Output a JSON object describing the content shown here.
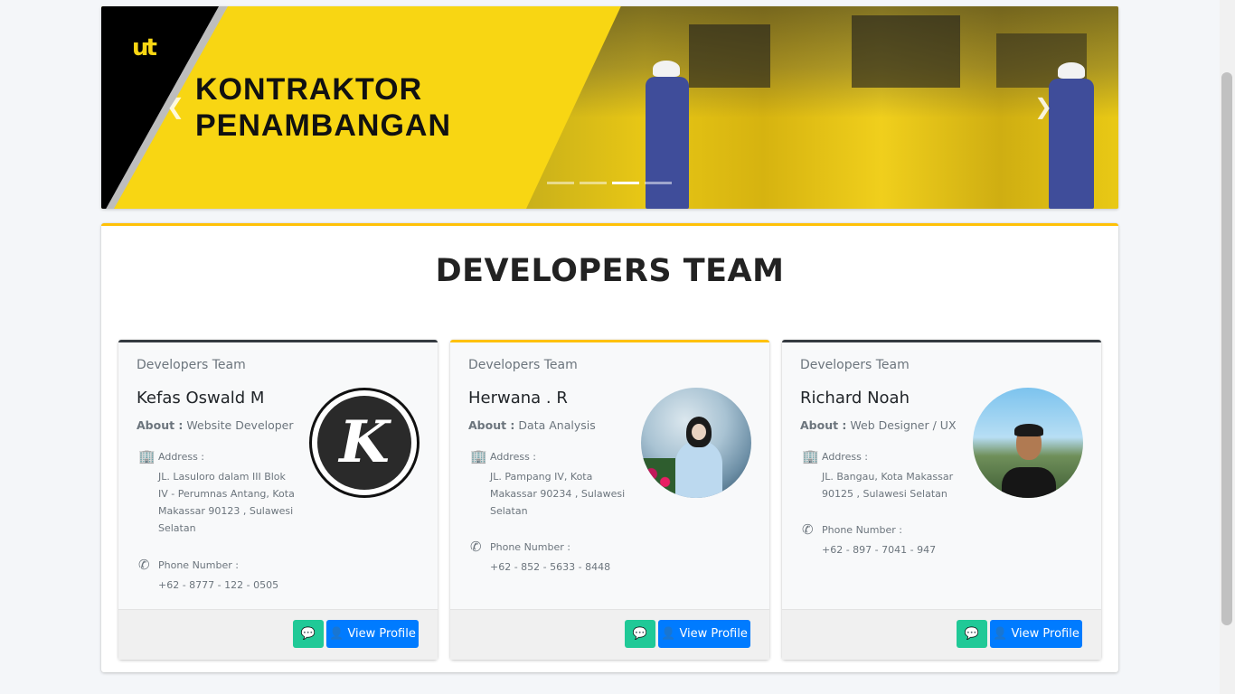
{
  "banner": {
    "headline_line1": "KONTRAKTOR",
    "headline_line2": "PENAMBANGAN",
    "logo_text": "ut",
    "prev_icon": "chevron-left-icon",
    "next_icon": "chevron-right-icon",
    "slides_count": 4,
    "active_slide": 3
  },
  "section": {
    "title": "DEVELOPERS TEAM"
  },
  "developers": [
    {
      "header": "Developers Team",
      "name": "Kefas Oswald M",
      "about_label": "About :",
      "about": "Website Developer",
      "address_label": "Address :",
      "address": "JL. Lasuloro dalam III Blok IV - Perumnas Antang, Kota Makassar 90123 , Sulawesi Selatan",
      "phone_label": "Phone Number :",
      "phone": "+62 - 8777 - 122 - 0505",
      "view_label": "View Profile"
    },
    {
      "header": "Developers Team",
      "name": "Herwana . R",
      "about_label": "About :",
      "about": "Data Analysis",
      "address_label": "Address :",
      "address": "JL. Pampang IV, Kota Makassar 90234 , Sulawesi Selatan",
      "phone_label": "Phone Number :",
      "phone": "+62 - 852 - 5633 - 8448",
      "view_label": "View Profile"
    },
    {
      "header": "Developers Team",
      "name": "Richard Noah",
      "about_label": "About :",
      "about": "Web Designer / UX",
      "address_label": "Address :",
      "address": "JL. Bangau, Kota Makassar 90125 , Sulawesi Selatan",
      "phone_label": "Phone Number :",
      "phone": "+62 - 897 - 7041 - 947",
      "view_label": "View Profile"
    }
  ],
  "avatars": {
    "k_letter": "K"
  },
  "colors": {
    "accent_yellow": "#ffc107",
    "dark_border": "#343a40",
    "chat_button": "#20c997",
    "primary_button": "#007bff"
  },
  "icons": {
    "address": "building-icon",
    "phone": "phone-icon",
    "chat": "comments-icon",
    "user": "user-icon"
  }
}
